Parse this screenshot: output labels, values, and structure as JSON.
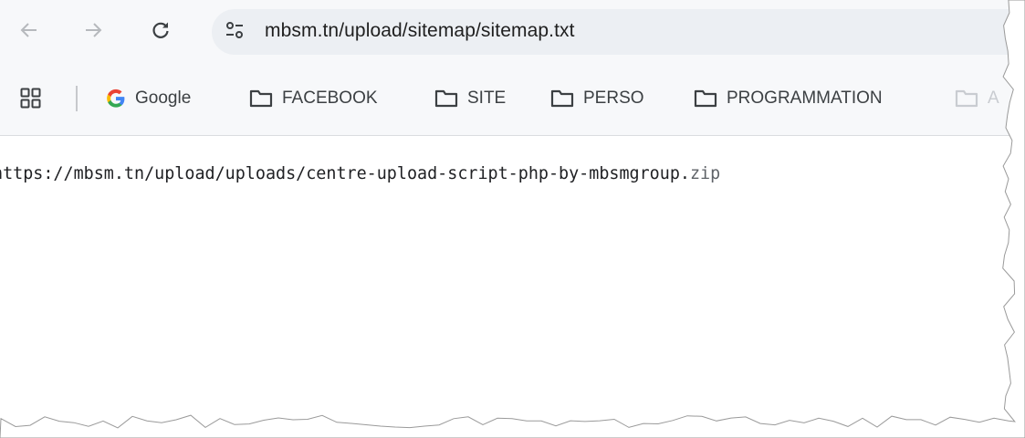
{
  "browser": {
    "nav": {
      "back_icon": "arrow-left-icon",
      "forward_icon": "arrow-right-icon",
      "reload_icon": "reload-icon",
      "site_info_icon": "tune-icon"
    },
    "address_bar": {
      "url": "mbsm.tn/upload/sitemap/sitemap.txt"
    },
    "bookmarks": {
      "apps_icon": "apps-grid-icon",
      "items": [
        {
          "label": "Google",
          "icon": "google-icon"
        },
        {
          "label": "FACEBOOK",
          "icon": "folder-icon"
        },
        {
          "label": "SITE",
          "icon": "folder-icon"
        },
        {
          "label": "PERSO",
          "icon": "folder-icon"
        },
        {
          "label": "PROGRAMMATION",
          "icon": "folder-icon"
        },
        {
          "label": "A",
          "icon": "folder-icon"
        }
      ]
    }
  },
  "page": {
    "text_line_main": "https://mbsm.tn/upload/uploads/centre-upload-script-php-by-mbsmgroup.",
    "text_line_ext": "zip"
  },
  "colors": {
    "chrome_bg": "#f7f8fa",
    "omnibox_bg": "#eceff3",
    "text": "#202124",
    "muted_ext": "#5f6368",
    "google_blue": "#4285f4",
    "google_red": "#ea4335",
    "google_yellow": "#fbbc05",
    "google_green": "#34a853"
  }
}
